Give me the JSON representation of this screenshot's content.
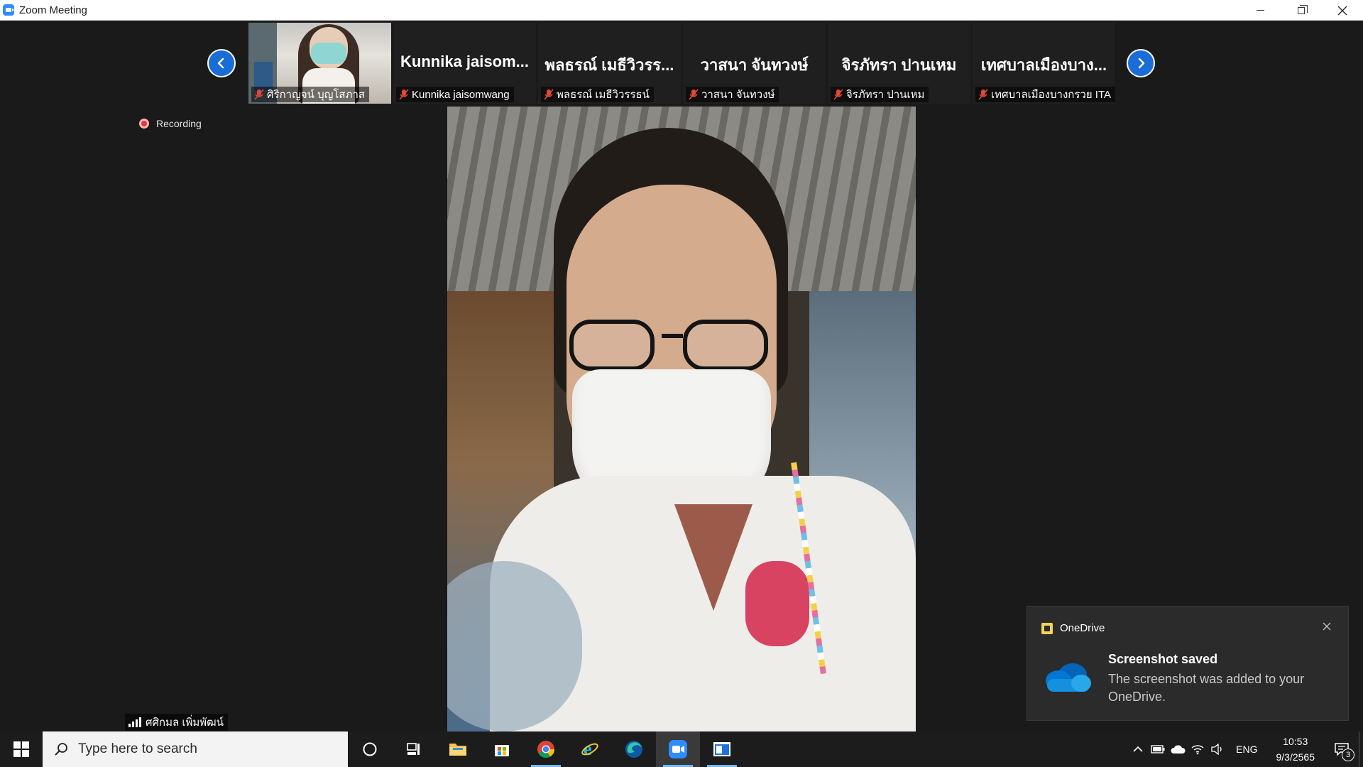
{
  "window": {
    "title": "Zoom Meeting",
    "app_icon": "zoom-camera-icon"
  },
  "gallery": {
    "prev_icon": "chevron-left-icon",
    "next_icon": "chevron-right-icon",
    "tiles": [
      {
        "big_name": "",
        "name": "ศิริกาญจน์ บุญโสภาส",
        "muted": true,
        "has_video": true
      },
      {
        "big_name": "Kunnika  jaisom...",
        "name": "Kunnika jaisomwang",
        "muted": true,
        "has_video": false
      },
      {
        "big_name": "พลธรณ์ เมธีวิวรร...",
        "name": "พลธรณ์ เมธีวิวรรธน์",
        "muted": true,
        "has_video": false
      },
      {
        "big_name": "วาสนา จันทวงษ์",
        "name": "วาสนา จันทวงษ์",
        "muted": true,
        "has_video": false
      },
      {
        "big_name": "จิรภัทรา ปานเหม",
        "name": "จิรภัทรา ปานเหม",
        "muted": true,
        "has_video": false
      },
      {
        "big_name": "เทศบาลเมืองบาง...",
        "name": "เทศบาลเมืองบางกรวย ITA",
        "muted": true,
        "has_video": false
      }
    ]
  },
  "recording": {
    "label": "Recording",
    "color": "#e03b3b"
  },
  "active_speaker": {
    "name": "ศศิกมล เพิ่มพัฒน์"
  },
  "toast": {
    "app": "OneDrive",
    "title": "Screenshot saved",
    "body": "The screenshot was added to your OneDrive.",
    "icon": "onedrive-cloud-icon",
    "close_icon": "close-icon"
  },
  "taskbar": {
    "search_placeholder": "Type here to search",
    "pinned": [
      {
        "name": "cortana-icon",
        "active": false,
        "running": false
      },
      {
        "name": "task-view-icon",
        "active": false,
        "running": false
      },
      {
        "name": "file-explorer-icon",
        "active": false,
        "running": false
      },
      {
        "name": "microsoft-store-icon",
        "active": false,
        "running": false
      },
      {
        "name": "chrome-icon",
        "active": false,
        "running": true
      },
      {
        "name": "internet-explorer-icon",
        "active": false,
        "running": false
      },
      {
        "name": "edge-icon",
        "active": false,
        "running": false
      },
      {
        "name": "zoom-icon",
        "active": true,
        "running": true
      },
      {
        "name": "whiteboard-app-icon",
        "active": false,
        "running": true
      }
    ],
    "tray": {
      "language": "ENG",
      "time": "10:53",
      "date": "9/3/2565",
      "notification_count": "3"
    }
  },
  "colors": {
    "accent": "#2d8cff",
    "nav_arrow": "#1a6dd6",
    "muted_mic": "#e0483e",
    "background": "#1a1a1a"
  }
}
